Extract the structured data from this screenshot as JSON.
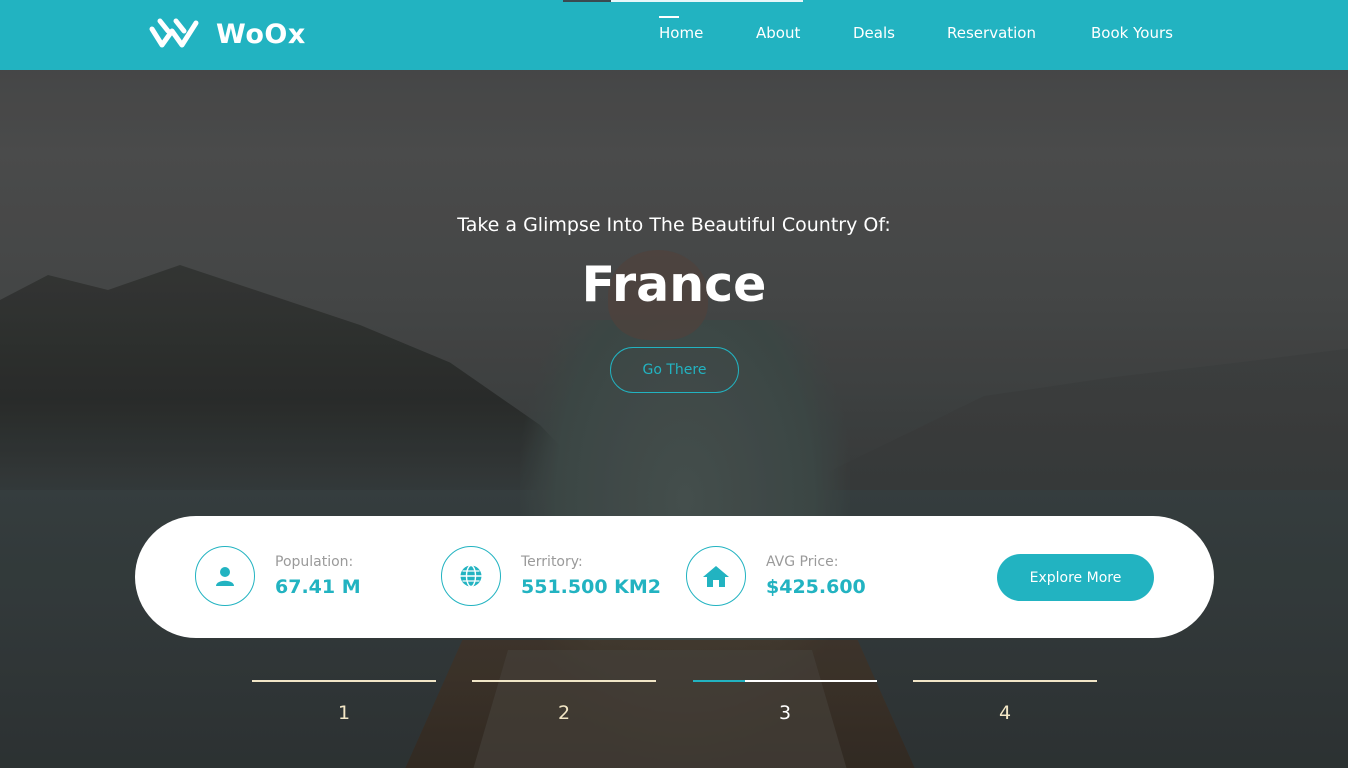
{
  "header": {
    "logo_text": "WoOx",
    "nav": [
      {
        "label": "Home",
        "active": true
      },
      {
        "label": "About",
        "active": false
      },
      {
        "label": "Deals",
        "active": false
      },
      {
        "label": "Reservation",
        "active": false
      },
      {
        "label": "Book Yours",
        "active": false
      }
    ]
  },
  "hero": {
    "subtitle": "Take a Glimpse Into The Beautiful Country Of:",
    "title": "France",
    "cta_label": "Go There"
  },
  "info_card": {
    "stats": [
      {
        "label": "Population:",
        "value": "67.41 M",
        "icon": "user-icon"
      },
      {
        "label": "Territory:",
        "value": "551.500 KM2",
        "icon": "globe-icon"
      },
      {
        "label": "AVG Price:",
        "value": "$425.600",
        "icon": "home-icon"
      }
    ],
    "button_label": "Explore More"
  },
  "pager": {
    "items": [
      "1",
      "2",
      "3",
      "4"
    ],
    "active_index": 2,
    "active_progress": 0.28
  },
  "colors": {
    "accent": "#22b3c1",
    "pager_line": "#f1e6c7"
  }
}
